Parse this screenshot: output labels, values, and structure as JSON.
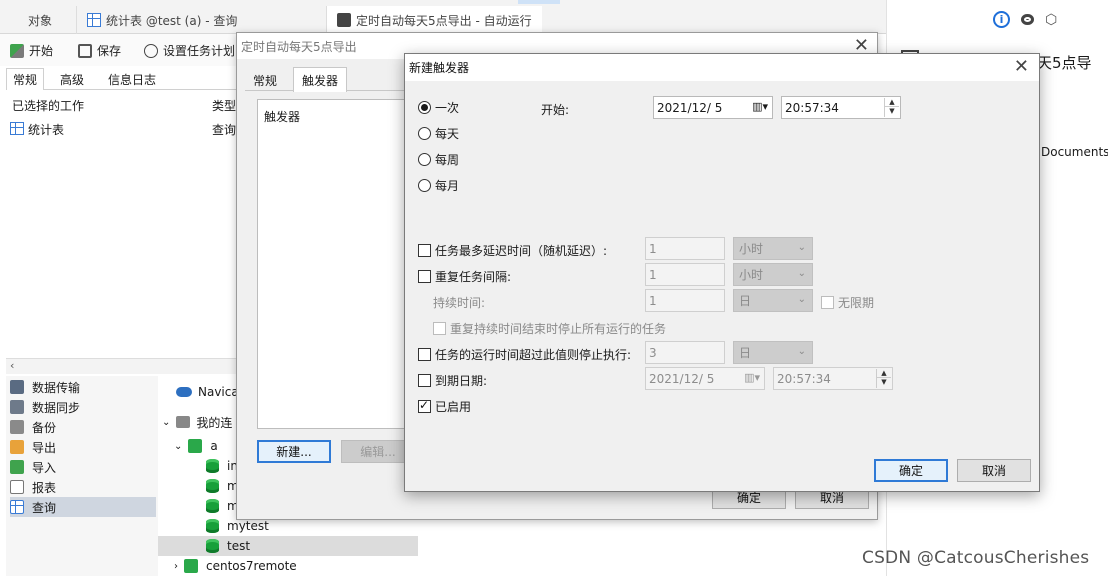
{
  "top_tabs": [
    {
      "label": "对象"
    },
    {
      "label": "统计表 @test (a) - 查询"
    },
    {
      "label": "定时自动每天5点导出 - 自动运行"
    }
  ],
  "toolbar": {
    "start": "开始",
    "save": "保存",
    "schedule": "设置任务计划"
  },
  "left_tabs": [
    "常规",
    "高级",
    "信息日志"
  ],
  "jobs": {
    "col_selected": "已选择的工作",
    "col_type": "类型",
    "row_name": "统计表",
    "row_type": "查询"
  },
  "left_nav": [
    "数据传输",
    "数据同步",
    "备份",
    "导出",
    "导入",
    "报表",
    "查询"
  ],
  "tree": {
    "navicat": "Navica",
    "myconn": "我的连",
    "conn_a": "a",
    "dbs": [
      "in",
      "m",
      "m",
      "mytest",
      "test"
    ],
    "conn_remote": "centos7remote"
  },
  "right_panel": {
    "title_fragment": "天5点导",
    "path_fragment": "Documents\\"
  },
  "dialog_back": {
    "title": "定时自动每天5点导出",
    "tabs": [
      "常规",
      "触发器"
    ],
    "list_header": "触发器",
    "new_btn": "新建...",
    "edit_btn": "编辑...",
    "ok": "确定",
    "cancel": "取消"
  },
  "dialog_front": {
    "title": "新建触发器",
    "schedule_options": [
      "一次",
      "每天",
      "每周",
      "每月"
    ],
    "selected_option": "一次",
    "start_label": "开始:",
    "start_date": "2021/12/  5",
    "start_time": "20:57:34",
    "random_delay": {
      "label": "任务最多延迟时间（随机延迟）:",
      "value": "1",
      "unit": "小时",
      "checked": false
    },
    "repeat": {
      "label": "重复任务间隔:",
      "value": "1",
      "unit": "小时",
      "checked": false
    },
    "duration": {
      "label": "持续时间:",
      "value": "1",
      "unit": "日"
    },
    "indefinite": {
      "label": "无限期",
      "checked": false
    },
    "stop_all": {
      "label": "重复持续时间结束时停止所有运行的任务",
      "checked": false
    },
    "stop_if_longer": {
      "label": "任务的运行时间超过此值则停止执行:",
      "value": "3",
      "unit": "日",
      "checked": false
    },
    "expire": {
      "label": "到期日期:",
      "date": "2021/12/  5",
      "time": "20:57:34",
      "checked": false
    },
    "enabled": {
      "label": "已启用",
      "checked": true
    },
    "ok": "确定",
    "cancel": "取消"
  },
  "watermark": "CSDN @CatcousCherishes",
  "colors": {
    "accent": "#2f7ad6",
    "db_green": "#18a03a",
    "dialog_bg": "#f0f0f0"
  }
}
